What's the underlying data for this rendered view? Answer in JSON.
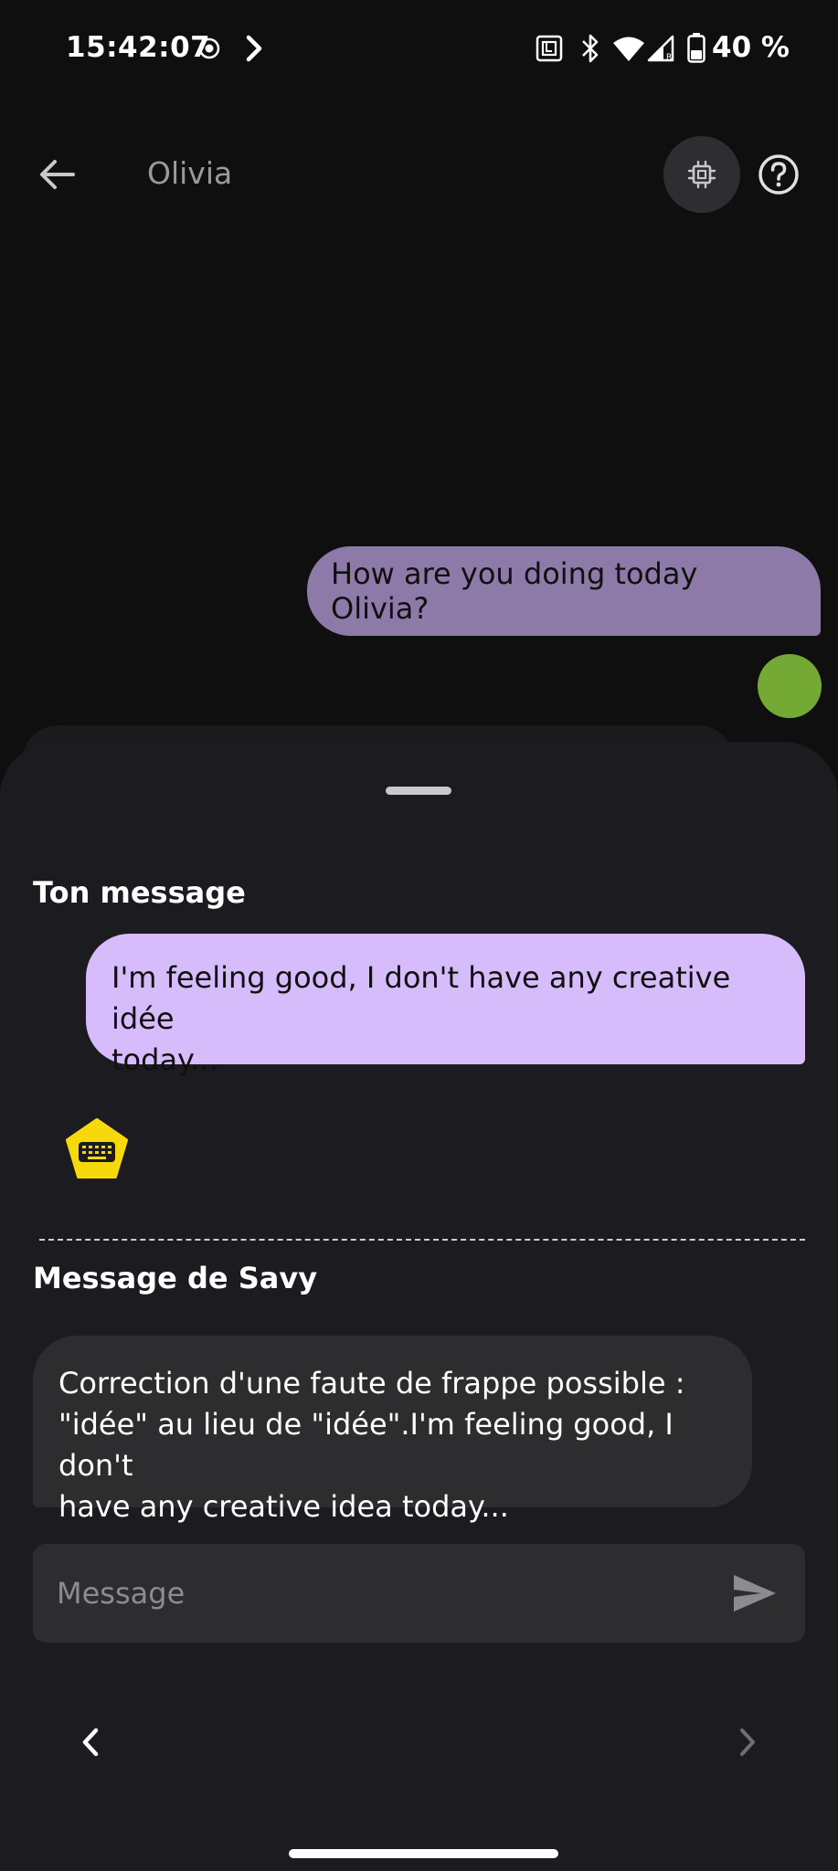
{
  "status_bar": {
    "time": "15:42:07",
    "battery": "40 %",
    "icons": [
      "record-icon",
      "chevron-right-icon",
      "nfc-icon",
      "bluetooth-icon",
      "wifi-icon",
      "signal-icon",
      "battery-icon"
    ]
  },
  "header": {
    "title": "Olivia",
    "actions": [
      "back-arrow-icon",
      "chip-icon",
      "help-icon"
    ]
  },
  "chat": {
    "user_message": "How are you doing today Olivia?",
    "user_avatar_color": "#73a934"
  },
  "sheet": {
    "your_message_title": "Ton message",
    "your_message_line1": "I'm feeling good, I don't have any creative idée",
    "your_message_line2": "today...",
    "savy_title": "Message de Savy",
    "savy_message_line1": "Correction d'une faute de frappe possible :",
    "savy_message_line2": "\"idée\" au lieu de \"idée\".I'm feeling good, I don't",
    "savy_message_line3": "have any creative idea today...",
    "input_placeholder": "Message",
    "input_value": ""
  },
  "colors": {
    "background": "#0f0f10",
    "sheet": "#1c1b1f",
    "user_bubble": "#8e7aa8",
    "your_message_bubble": "#d6bcfa",
    "savy_bubble": "#2d2d30",
    "keyboard_badge": "#f5d90a"
  }
}
